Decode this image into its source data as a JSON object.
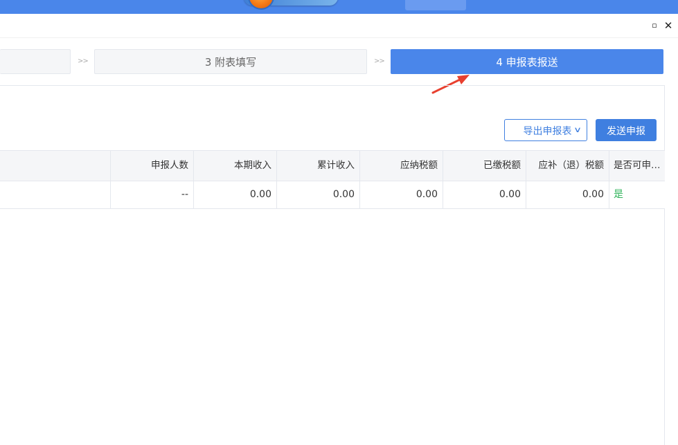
{
  "steps": {
    "step3_label": "3 附表填写",
    "step4_label": "4 申报表报送",
    "separator": ">>"
  },
  "window_controls": {
    "restore_glyph": "▫",
    "close_glyph": "✕"
  },
  "toolbar": {
    "export_label": "导出申报表",
    "export_icon": "chevron-down-icon",
    "send_label": "发送申报"
  },
  "table": {
    "columns": [
      "",
      "申报人数",
      "本期收入",
      "累计收入",
      "应纳税额",
      "已缴税额",
      "应补（退）税额",
      "是否可申…"
    ],
    "rows": [
      [
        "",
        "--",
        "0.00",
        "0.00",
        "0.00",
        "0.00",
        "0.00",
        "是"
      ]
    ]
  },
  "colors": {
    "accent": "#4a86ea",
    "button": "#3f7fe0",
    "status_yes": "#2fb35a",
    "annotation_arrow": "#e8402f"
  }
}
